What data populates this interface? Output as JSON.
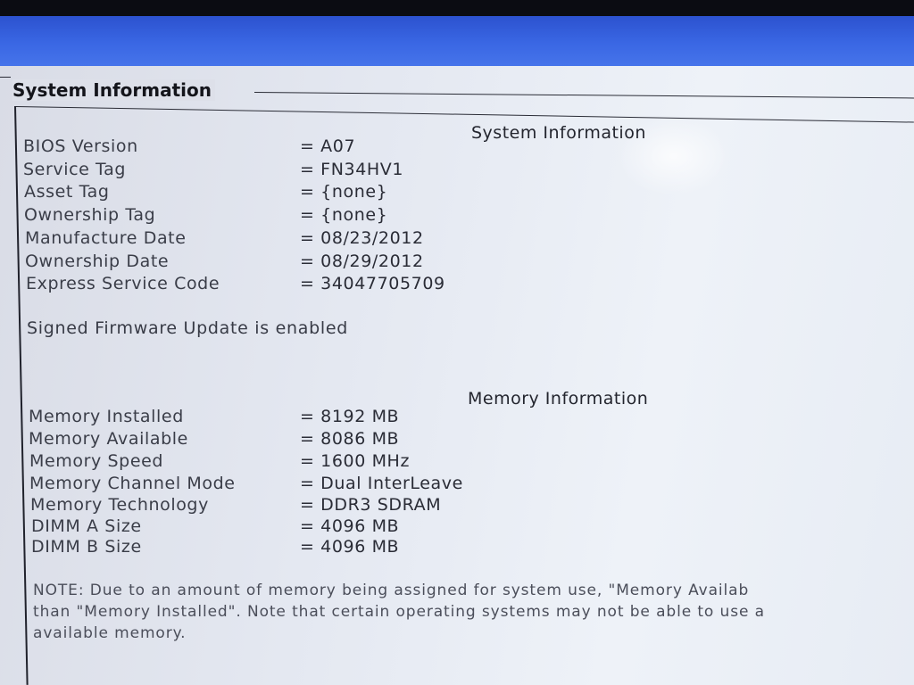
{
  "group_title": "System Information",
  "system": {
    "heading": "System Information",
    "rows": [
      {
        "label": "BIOS Version",
        "value": "A07"
      },
      {
        "label": "Service Tag",
        "value": "FN34HV1"
      },
      {
        "label": "Asset Tag",
        "value": "{none}"
      },
      {
        "label": "Ownership Tag",
        "value": "{none}"
      },
      {
        "label": "Manufacture Date",
        "value": "08/23/2012"
      },
      {
        "label": "Ownership Date",
        "value": "08/29/2012"
      },
      {
        "label": "Express Service Code",
        "value": "34047705709"
      }
    ],
    "firmware_note": "Signed Firmware Update is enabled"
  },
  "memory": {
    "heading": "Memory Information",
    "rows": [
      {
        "label": "Memory Installed",
        "value": "8192 MB"
      },
      {
        "label": "Memory Available",
        "value": "8086 MB"
      },
      {
        "label": "Memory Speed",
        "value": "1600 MHz"
      },
      {
        "label": "Memory Channel Mode",
        "value": "Dual InterLeave"
      },
      {
        "label": "Memory Technology",
        "value": "DDR3 SDRAM"
      },
      {
        "label": "DIMM A Size",
        "value": "4096 MB"
      },
      {
        "label": "DIMM B Size",
        "value": "4096 MB"
      }
    ]
  },
  "note": {
    "line1": "NOTE: Due to an amount of memory being assigned for system use, \"Memory Availab",
    "line2": "than \"Memory Installed\". Note that certain operating systems may not be able to use a",
    "line3": "available memory."
  }
}
